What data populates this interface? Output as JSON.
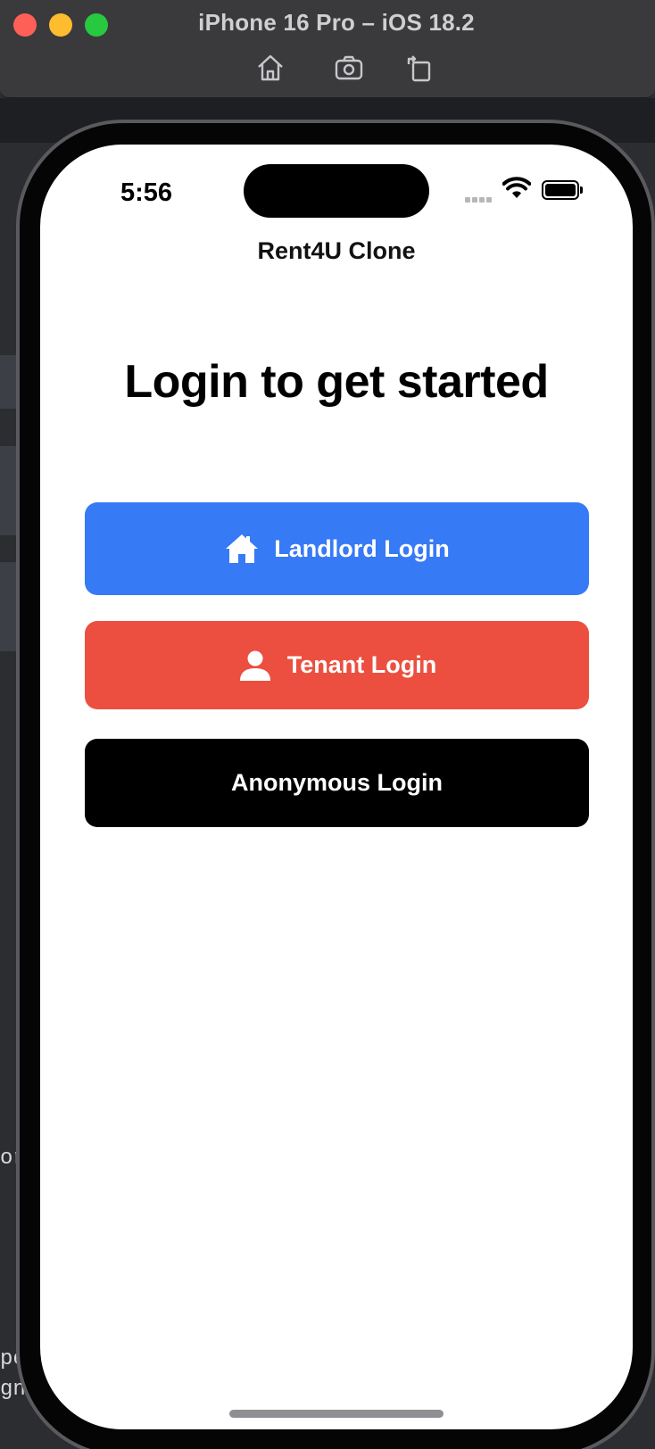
{
  "window": {
    "title": "iPhone 16 Pro – iOS 18.2",
    "toolbar_icons": [
      "home-icon",
      "screenshot-icon",
      "rotate-icon"
    ]
  },
  "status_bar": {
    "time": "5:56"
  },
  "app": {
    "nav_title": "Rent4U Clone",
    "heading": "Login to get started",
    "buttons": {
      "landlord": {
        "label": "Landlord Login",
        "icon": "house-icon",
        "color": "#377af5"
      },
      "tenant": {
        "label": "Tenant Login",
        "icon": "person-icon",
        "color": "#ec4f3f"
      },
      "anonymous": {
        "label": "Anonymous Login",
        "color": "#000000"
      }
    }
  },
  "background_fragments": {
    "left_1": "or",
    "left_2": "pe",
    "left_3": "gn:"
  }
}
